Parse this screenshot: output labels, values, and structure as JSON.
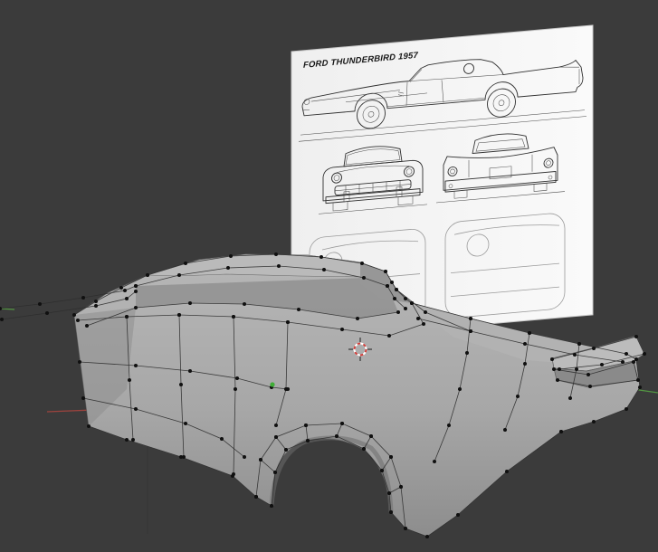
{
  "viewport": {
    "background_color": "#3b3b3b"
  },
  "blueprint": {
    "title": "FORD THUNDERBIRD 1957",
    "paper_color": "#f4f4f4"
  },
  "colors": {
    "axis_x": "#a8443e",
    "axis_y": "#56a043",
    "cursor_red": "#d1403c",
    "cursor_white": "#ffffff",
    "vertex": "#101010",
    "selected_vertex": "#3fae37",
    "wire": "#2e2e2e"
  }
}
